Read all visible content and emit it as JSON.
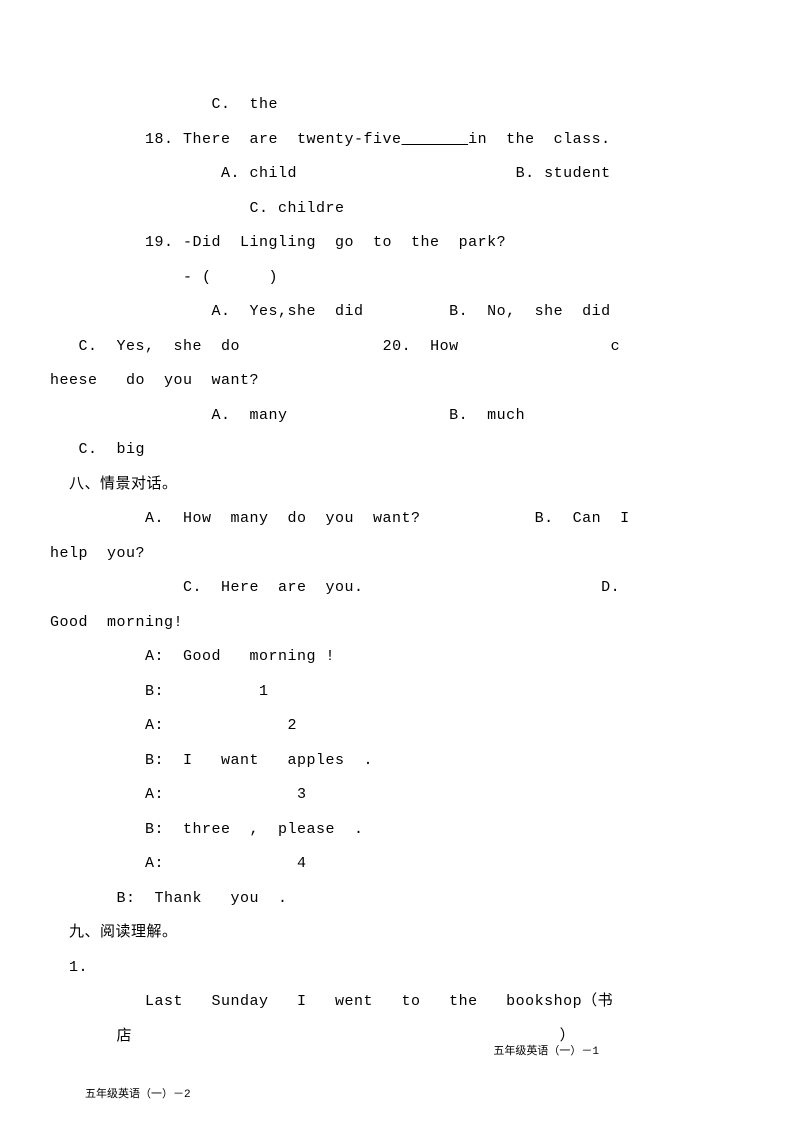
{
  "q17": {
    "optC": "C.  the"
  },
  "q18": {
    "stem_pre": "18. There  are  twenty-five",
    "blank": "       ",
    "stem_post": "in  the  class.",
    "optA": "A. child",
    "optB": "B. student",
    "optC": "C. childre"
  },
  "q19": {
    "stem": "19. -Did  Lingling  go  to  the  park?",
    "response": "- (      )",
    "optA": "A.  Yes,she  did",
    "optB": "B.  No,  she  did",
    "optC": "C.  Yes,  she  do"
  },
  "q20": {
    "stem_pre": "20.  How",
    "stem_word": "c",
    "stem_line2": "heese   do  you  want?",
    "optA": "A.  many",
    "optB": "B.  much",
    "optC": "C.  big"
  },
  "section8": {
    "title": "八、情景对话。",
    "optA": "A.  How  many  do  you  want?",
    "optB": "B.  Can  I",
    "optB_line2": "help  you?",
    "optC": "C.  Here  are  you.",
    "optD": "D.",
    "optD_line2": "Good  morning!",
    "dialog": {
      "a1": "A:  Good   morning !",
      "b1": "B:          1",
      "a2": "A:             2",
      "b2": "B:  I   want   apples  .",
      "a3": "A:              3",
      "b3": "B:  three  ,  please  .",
      "a4": "A:              4",
      "b4": "B:  Thank   you  ."
    }
  },
  "section9": {
    "title": "九、阅读理解。",
    "item1": "1.",
    "para_start": "Last   Sunday   I   went   to   the   bookshop（书",
    "para_line2_left": "店",
    "para_line2_right": "）"
  },
  "footer": {
    "left": "五年级英语（一）－2",
    "right": "五年级英语（一）－1"
  }
}
